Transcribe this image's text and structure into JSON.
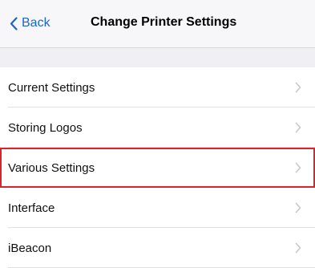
{
  "navbar": {
    "back_label": "Back",
    "title": "Change Printer Settings",
    "back_icon": "chevron-left-icon"
  },
  "list": {
    "items": [
      {
        "label": "Current Settings",
        "icon": "chevron-right-icon"
      },
      {
        "label": "Storing Logos",
        "icon": "chevron-right-icon"
      },
      {
        "label": "Various Settings",
        "icon": "chevron-right-icon",
        "highlighted": true
      },
      {
        "label": "Interface",
        "icon": "chevron-right-icon"
      },
      {
        "label": "iBeacon",
        "icon": "chevron-right-icon"
      }
    ]
  },
  "colors": {
    "accent": "#1a66c4",
    "highlight": "#d9232d",
    "chevron": "#c7c7cc"
  }
}
